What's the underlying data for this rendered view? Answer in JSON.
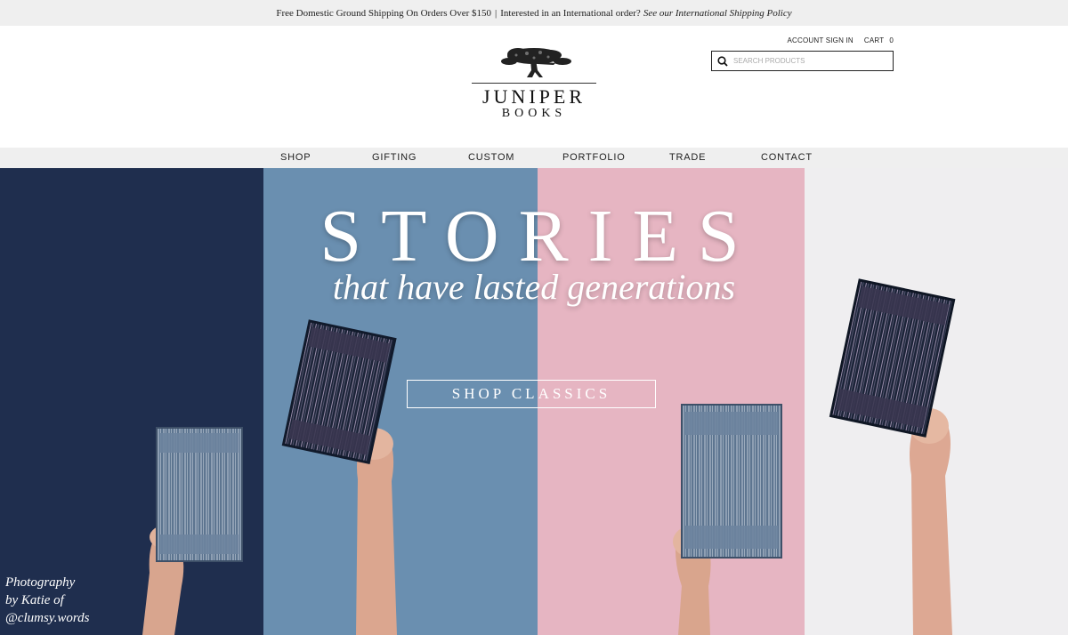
{
  "announcement": {
    "shipping": "Free Domestic Ground Shipping On Orders Over $150",
    "separator": "|",
    "intl_question": "Interested in an International order?",
    "intl_link": "See our International Shipping Policy"
  },
  "header": {
    "brand_line1": "JUNIPER",
    "brand_line2": "BOOKS",
    "account_label": "ACCOUNT SIGN IN",
    "cart_label": "CART",
    "cart_count": "0",
    "search_placeholder": "SEARCH PRODUCTS"
  },
  "nav": {
    "items": [
      {
        "label": "SHOP"
      },
      {
        "label": "GIFTING"
      },
      {
        "label": "CUSTOM"
      },
      {
        "label": "PORTFOLIO"
      },
      {
        "label": "TRADE"
      },
      {
        "label": "CONTACT"
      }
    ]
  },
  "hero": {
    "title": "STORIES",
    "subtitle": "that have lasted generations",
    "cta_label": "SHOP CLASSICS",
    "credit_line1": "Photography",
    "credit_line2": "by Katie of",
    "credit_line3": "@clumsy.words",
    "colors": {
      "navy": "#1f2e4e",
      "blue": "#6a8fb0",
      "pink": "#e6b5c2",
      "white": "#efeef0"
    }
  },
  "icons": [
    "tree-logo-icon",
    "search-icon",
    "book-icon",
    "hand-icon"
  ]
}
